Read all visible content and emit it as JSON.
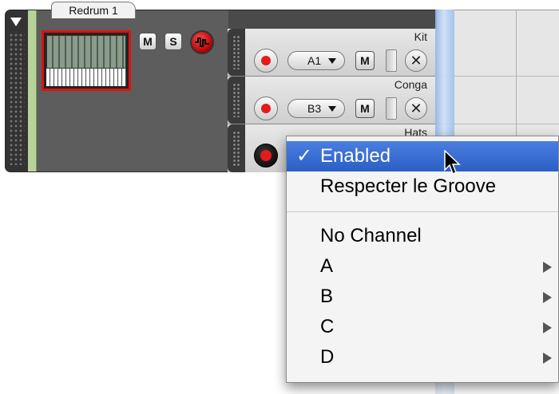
{
  "track": {
    "tab_label": "Redrum 1",
    "mute_label": "M",
    "solo_label": "S"
  },
  "lanes": [
    {
      "name": "Kit",
      "note": "A1",
      "mute_label": "M",
      "recording": false
    },
    {
      "name": "Conga",
      "note": "B3",
      "mute_label": "M",
      "recording": false
    },
    {
      "name": "Hats",
      "note": "",
      "mute_label": "M",
      "recording": true
    }
  ],
  "menu": {
    "items": [
      {
        "label": "Enabled",
        "checked": true,
        "selected": true,
        "submenu": false
      },
      {
        "label": "Respecter le Groove",
        "checked": false,
        "selected": false,
        "submenu": false
      },
      {
        "label": "No Channel",
        "checked": false,
        "selected": false,
        "submenu": false
      },
      {
        "label": "A",
        "checked": false,
        "selected": false,
        "submenu": true
      },
      {
        "label": "B",
        "checked": false,
        "selected": false,
        "submenu": true
      },
      {
        "label": "C",
        "checked": false,
        "selected": false,
        "submenu": true
      },
      {
        "label": "D",
        "checked": false,
        "selected": false,
        "submenu": true
      }
    ],
    "check_glyph": "✓"
  },
  "colors": {
    "accent_selected": "#2c5fc4",
    "record_red": "#e21b1b",
    "instrument_border": "#dd1111",
    "track_green": "#b7d39a"
  },
  "icons": {
    "collapse": "triangle-down-icon",
    "instrument": "redrum-thumbnail-icon",
    "record_enable": "record-dot-icon",
    "remove_lane": "close-x-icon",
    "submenu": "chevron-right-icon",
    "cursor": "mouse-pointer-icon"
  }
}
